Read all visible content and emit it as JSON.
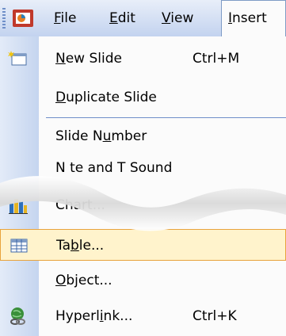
{
  "menubar": {
    "items": [
      {
        "label": "File",
        "u": "F",
        "rest": "ile"
      },
      {
        "label": "Edit",
        "u": "E",
        "rest": "dit"
      },
      {
        "label": "View",
        "u": "V",
        "rest": "iew"
      },
      {
        "label": "Insert",
        "u": "I",
        "rest": "nsert"
      }
    ]
  },
  "menu": {
    "new_slide": {
      "pre": "",
      "u": "N",
      "post": "ew Slide",
      "shortcut": "Ctrl+M"
    },
    "duplicate_slide": {
      "pre": "",
      "u": "D",
      "post": "uplicate Slide"
    },
    "slide_number": {
      "pre": "Slide N",
      "u": "u",
      "post": "mber"
    },
    "note_and_sound": {
      "text": "N te and T Sound"
    },
    "chart": {
      "text": "Chart..."
    },
    "table": {
      "pre": "Ta",
      "u": "b",
      "post": "le..."
    },
    "object": {
      "pre": "",
      "u": "O",
      "post": "bject..."
    },
    "hyperlink": {
      "pre": "Hyperl",
      "u": "i",
      "post": "nk...",
      "shortcut": "Ctrl+K"
    }
  },
  "colors": {
    "accent": "#6f8fc9",
    "highlight": "#fff3cc",
    "highlight_border": "#e8a33c"
  }
}
